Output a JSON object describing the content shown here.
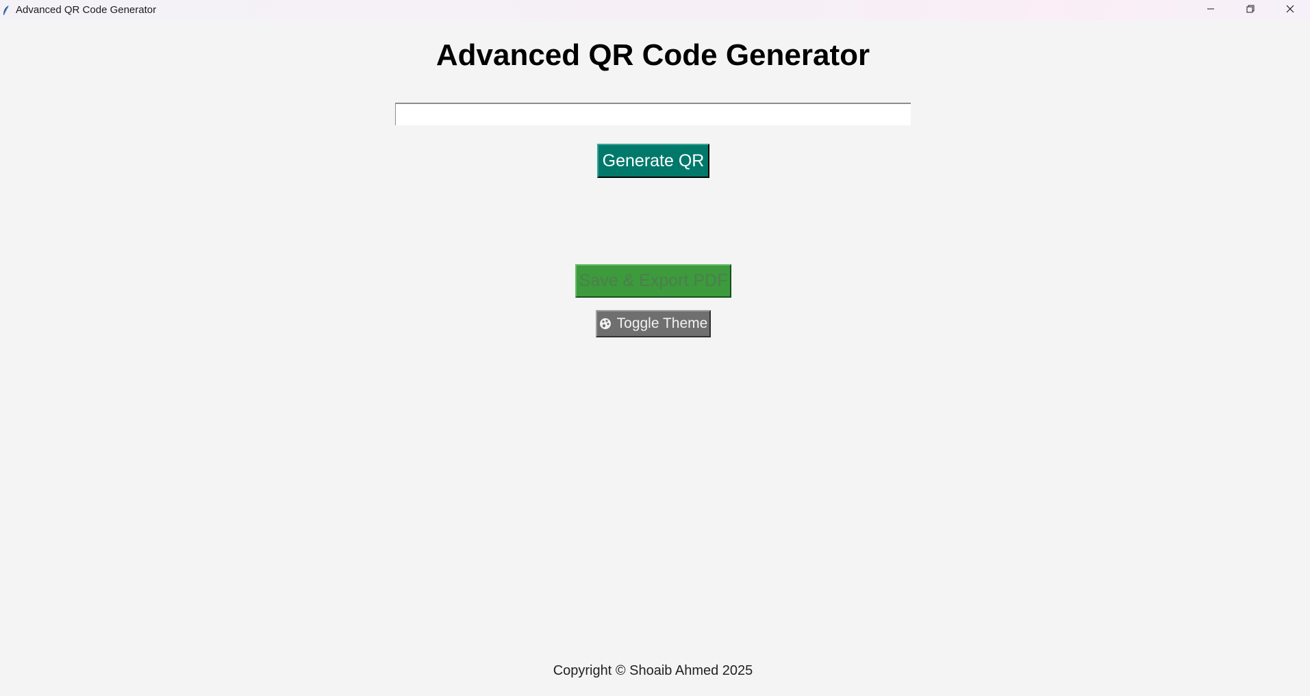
{
  "window": {
    "title": "Advanced QR Code Generator",
    "icon": "feather-icon",
    "controls": [
      "minimize-icon",
      "restore-icon",
      "close-icon"
    ]
  },
  "main": {
    "heading": "Advanced QR Code Generator",
    "input": {
      "value": "",
      "placeholder": ""
    },
    "generate_label": "Generate QR",
    "save_label": "Save & Export PDF",
    "toggle_label": "Toggle Theme",
    "toggle_icon": "palette-icon"
  },
  "footer": {
    "text": "Copyright © Shoaib Ahmed 2025"
  },
  "colors": {
    "background": "#f4f4f4",
    "generate_button": "#00796b",
    "save_button": "#3d9a3d",
    "toggle_button": "#6f6f6f"
  }
}
